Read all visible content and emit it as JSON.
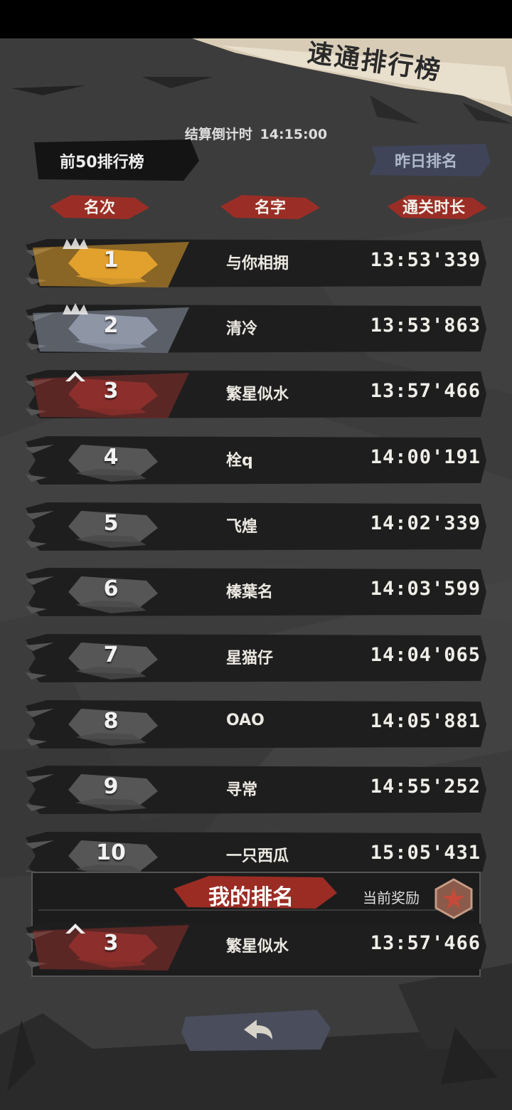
{
  "title": "速通排行榜",
  "countdown": {
    "label": "结算倒计时",
    "value": "14:15:00"
  },
  "tabs": {
    "top50": "前50排行榜",
    "yesterday": "昨日排名"
  },
  "columns": {
    "rank": "名次",
    "name": "名字",
    "time": "通关时长"
  },
  "rows": [
    {
      "rank": "1",
      "name": "与你相拥",
      "time": "13:53'339",
      "tier": "gold"
    },
    {
      "rank": "2",
      "name": "清冷",
      "time": "13:53'863",
      "tier": "silver"
    },
    {
      "rank": "3",
      "name": "繁星似水",
      "time": "13:57'466",
      "tier": "bronze"
    },
    {
      "rank": "4",
      "name": "栓q",
      "time": "14:00'191",
      "tier": "plain"
    },
    {
      "rank": "5",
      "name": "飞煌",
      "time": "14:02'339",
      "tier": "plain"
    },
    {
      "rank": "6",
      "name": "榛葉名",
      "time": "14:03'599",
      "tier": "plain"
    },
    {
      "rank": "7",
      "name": "星猫仔",
      "time": "14:04'065",
      "tier": "plain"
    },
    {
      "rank": "8",
      "name": "OAO",
      "time": "14:05'881",
      "tier": "plain"
    },
    {
      "rank": "9",
      "name": "寻常",
      "time": "14:55'252",
      "tier": "plain"
    },
    {
      "rank": "10",
      "name": "一只西瓜",
      "time": "15:05'431",
      "tier": "plain"
    }
  ],
  "my_rank": {
    "title": "我的排名",
    "reward_label": "当前奖励",
    "rank": "3",
    "name": "繁星似水",
    "time": "13:57'466",
    "tier": "bronze"
  },
  "colors": {
    "background": "#3b3b3b",
    "row_dark": "#1e1e1e",
    "gold": "#e2a12d",
    "silver": "#8e96a6",
    "bronze": "#8c2f2c",
    "plain_badge": "#6a6a6a",
    "header_red": "#a3342b",
    "banner_cream": "#e9dfcd"
  },
  "icons": {
    "back": "back-arrow-icon",
    "medal": "bronze-medal-icon",
    "crown": "crown-icon"
  }
}
